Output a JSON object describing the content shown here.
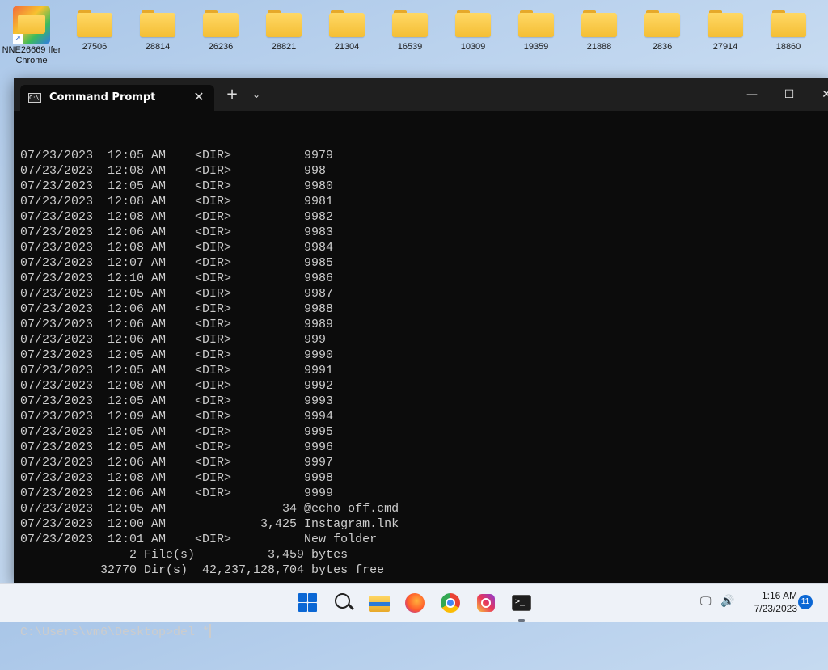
{
  "desktop": {
    "chrome_shortcut": {
      "label_line1": "NNE26669 Ifer",
      "label_line2": "Chrome",
      "arrow": "↗"
    },
    "folders": [
      "27506",
      "28814",
      "26236",
      "28821",
      "21304",
      "16539",
      "10309",
      "19359",
      "21888",
      "2836",
      "27914",
      "18860"
    ]
  },
  "terminal": {
    "tab_title": "Command Prompt",
    "tab_icon_text": "C:\\",
    "close_tab_glyph": "✕",
    "new_tab_glyph": "+",
    "dropdown_glyph": "⌄",
    "minimize_glyph": "—",
    "maximize_glyph": "☐",
    "close_glyph": "✕",
    "lines": [
      "07/23/2023  12:05 AM    <DIR>          9979",
      "07/23/2023  12:08 AM    <DIR>          998",
      "07/23/2023  12:05 AM    <DIR>          9980",
      "07/23/2023  12:08 AM    <DIR>          9981",
      "07/23/2023  12:08 AM    <DIR>          9982",
      "07/23/2023  12:06 AM    <DIR>          9983",
      "07/23/2023  12:08 AM    <DIR>          9984",
      "07/23/2023  12:07 AM    <DIR>          9985",
      "07/23/2023  12:10 AM    <DIR>          9986",
      "07/23/2023  12:05 AM    <DIR>          9987",
      "07/23/2023  12:06 AM    <DIR>          9988",
      "07/23/2023  12:06 AM    <DIR>          9989",
      "07/23/2023  12:06 AM    <DIR>          999",
      "07/23/2023  12:05 AM    <DIR>          9990",
      "07/23/2023  12:05 AM    <DIR>          9991",
      "07/23/2023  12:08 AM    <DIR>          9992",
      "07/23/2023  12:05 AM    <DIR>          9993",
      "07/23/2023  12:09 AM    <DIR>          9994",
      "07/23/2023  12:05 AM    <DIR>          9995",
      "07/23/2023  12:05 AM    <DIR>          9996",
      "07/23/2023  12:06 AM    <DIR>          9997",
      "07/23/2023  12:08 AM    <DIR>          9998",
      "07/23/2023  12:06 AM    <DIR>          9999",
      "07/23/2023  12:05 AM                34 @echo off.cmd",
      "07/23/2023  12:00 AM             3,425 Instagram.lnk",
      "07/23/2023  12:01 AM    <DIR>          New folder",
      "               2 File(s)          3,459 bytes",
      "           32770 Dir(s)  42,237,128,704 bytes free"
    ],
    "prompt": "C:\\Users\\vm6\\Desktop>del *"
  },
  "taskbar": {
    "clock_time": "1:16 AM",
    "clock_date": "7/23/2023",
    "notification_count": "11",
    "terminal_glyph": ">_",
    "network_glyph": "🖵",
    "volume_glyph": "🔊"
  },
  "colors": {
    "terminal_bg": "#0c0c0c",
    "terminal_text": "#cccccc",
    "accent": "#0b67d4"
  }
}
